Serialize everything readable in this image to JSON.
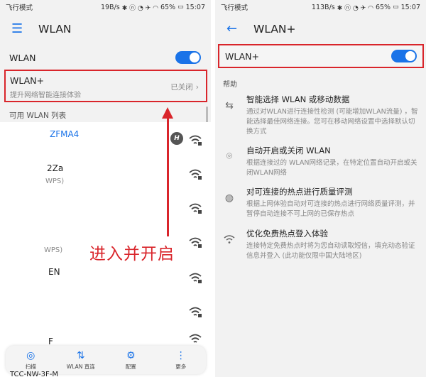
{
  "left": {
    "status": {
      "mode": "飞行模式",
      "speed": "19B/s",
      "battery": "65%",
      "time": "15:07"
    },
    "header": {
      "title": "WLAN"
    },
    "wlan_label": "WLAN",
    "wlanplus": {
      "title": "WLAN+",
      "subtitle": "提升网络智能连接体验",
      "state": "已关闭"
    },
    "available_label": "可用 WLAN 列表",
    "networks": [
      {
        "name": "ZFMA4",
        "sub": ""
      },
      {
        "name": "2Za",
        "sub": "WPS)"
      },
      {
        "name": "",
        "sub": ""
      },
      {
        "name": "",
        "sub": "WPS)"
      },
      {
        "name": "EN",
        "sub": ""
      },
      {
        "name": "",
        "sub": ""
      },
      {
        "name": "F",
        "sub": ""
      }
    ],
    "hi_badge": "H",
    "annotation": "进入并开启",
    "bottom_nav": [
      {
        "label": "扫描",
        "icon": "scan-icon"
      },
      {
        "label": "WLAN 直连",
        "icon": "wifi-direct-icon"
      },
      {
        "label": "配置",
        "icon": "gear-icon"
      },
      {
        "label": "更多",
        "icon": "more-icon"
      }
    ],
    "bottom_clip": "TCC-NW-3F-M"
  },
  "right": {
    "status": {
      "mode": "飞行模式",
      "speed": "113B/s",
      "battery": "65%",
      "time": "15:07"
    },
    "header": {
      "title": "WLAN+"
    },
    "wlanplus_label": "WLAN+",
    "help_label": "帮助",
    "features": [
      {
        "title": "智能选择 WLAN 或移动数据",
        "desc": "通过对WLAN进行连接性检测 (可能增加WLAN流量) ，智能选择最佳网络连接。您可在移动网络设置中选择默认切换方式",
        "icon": "switch-icon"
      },
      {
        "title": "自动开启或关闭 WLAN",
        "desc": "根据连接过的 WLAN网络记录，在特定位置自动开启或关闭WLAN网络",
        "icon": "location-icon"
      },
      {
        "title": "对可连接的热点进行质量评测",
        "desc": "根据上网体验自动对可连接的热点进行网络质量评测，并暂停自动连接不可上网的已保存热点",
        "icon": "globe-icon"
      },
      {
        "title": "优化免费热点登入体验",
        "desc": "连接特定免费热点时将为您自动读取短信，填充动态验证信息并登入 (此功能仅限中国大陆地区)",
        "icon": "wifi-icon"
      }
    ]
  },
  "colors": {
    "accent": "#1a73e8",
    "annotation": "#d9252b"
  }
}
